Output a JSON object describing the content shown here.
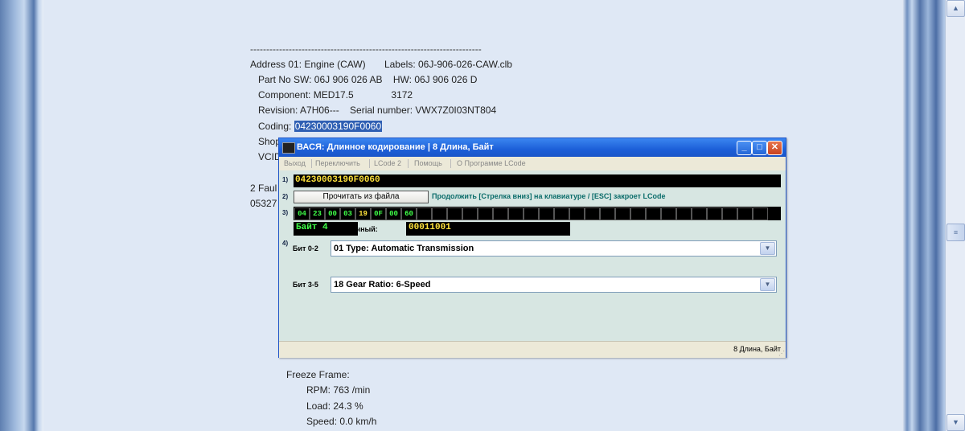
{
  "document": {
    "separator": "------------------------------------------------------------------------",
    "lines": [
      "Address 01: Engine (CAW)       Labels: 06J-906-026-CAW.clb",
      "   Part No SW: 06J 906 026 AB    HW: 06J 906 026 D",
      "   Component: MED17.5              3172",
      "   Revision: A7H06---    Serial number: VWX7Z0I03NT804"
    ],
    "coding_label": "   Coding: ",
    "coding_value": "04230003190F0060",
    "shop_fragment": "   Shop",
    "vcid_fragment": "   VCID",
    "faults_fragment": "2 Faul",
    "code_fragment": "05327",
    "freeze_frame": {
      "title": "Freeze Frame:",
      "rpm": "RPM: 763 /min",
      "load": "Load: 24.3 %",
      "speed": "Speed: 0.0 km/h"
    }
  },
  "dialog": {
    "title": "ВАСЯ: Длинное кодирование    | 8 Длина, Байт",
    "menu": [
      "Выход",
      "Переключить",
      "LCode 2",
      "Помощь",
      "О Программе LCode"
    ],
    "row_numbers": [
      "1)",
      "2)",
      "3)",
      "4)"
    ],
    "coding_hex": "04230003190F0060",
    "read_button": "Прочитать из файла",
    "hint": "Продолжить [Стрелка вниз] на клавиатуре / [ESC] закроет LCode",
    "bytes": [
      "04",
      "23",
      "00",
      "03",
      "19",
      "0F",
      "00",
      "60"
    ],
    "byte_label": "Байт 4",
    "binary_label": "Двоичный:",
    "binary_value": "00011001",
    "bit02_label": "Бит 0-2",
    "bit02_value": "01 Type: Automatic Transmission",
    "bit35_label": "Бит 3-5",
    "bit35_value": "18 Gear Ratio: 6-Speed",
    "status": "8 Длина, Байт"
  },
  "colors": {
    "titlebar": "#1c5fd8",
    "selection": "#2f5fb3",
    "yellow_text": "#ffe33c",
    "green_text": "#3fff48"
  }
}
